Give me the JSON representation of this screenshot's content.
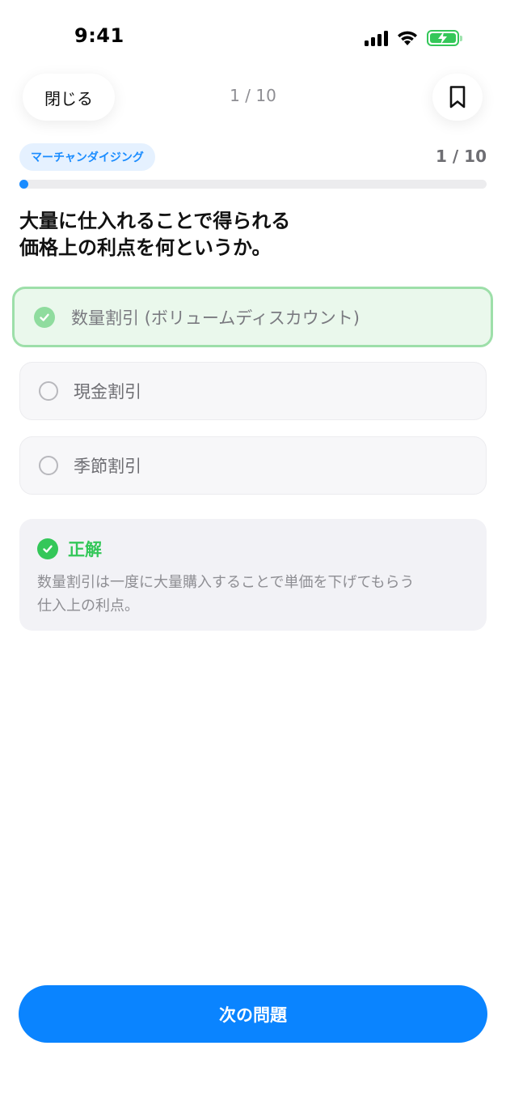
{
  "status_bar": {
    "time": "9:41"
  },
  "nav": {
    "close_label": "閉じる",
    "counter": "1 / 10"
  },
  "category": {
    "label": "マーチャンダイジング",
    "counter": "1 / 10"
  },
  "progress": {
    "current": 1,
    "total": 10,
    "color": "#1a8cff"
  },
  "question": {
    "line1": "大量に仕入れることで得られる",
    "line2": "価格上の利点を何というか。"
  },
  "options": [
    {
      "label": "数量割引 (ボリュームディスカウント)",
      "state": "correct-selected"
    },
    {
      "label": "現金割引",
      "state": "unselected"
    },
    {
      "label": "季節割引",
      "state": "unselected"
    }
  ],
  "explanation": {
    "result": "正解",
    "text_line1": "数量割引は一度に大量購入することで単価を下げてもらう",
    "text_line2": "仕入上の利点。"
  },
  "next_button": {
    "label": "次の問題"
  },
  "colors": {
    "accent": "#0a84ff",
    "success": "#34c759",
    "success_light": "#9ddfa9"
  }
}
